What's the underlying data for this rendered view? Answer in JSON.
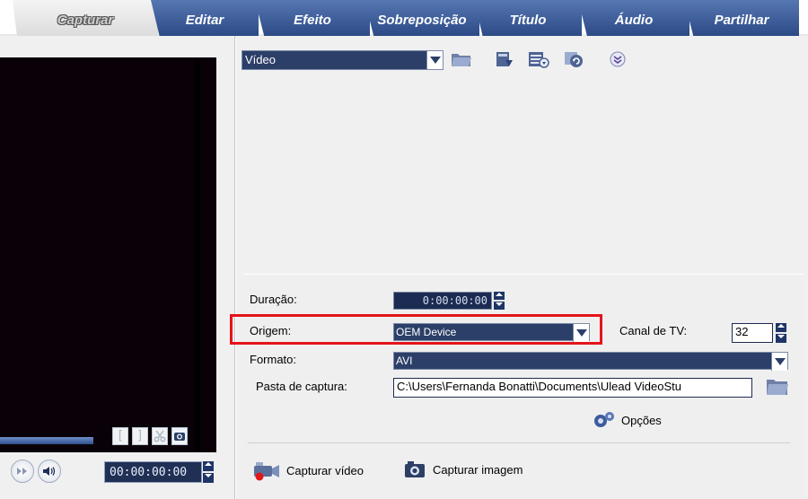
{
  "tabs": [
    {
      "label": "Capturar",
      "active": true
    },
    {
      "label": "Editar",
      "active": false
    },
    {
      "label": "Efeito",
      "active": false
    },
    {
      "label": "Sobreposição",
      "active": false
    },
    {
      "label": "Título",
      "active": false
    },
    {
      "label": "Áudio",
      "active": false
    },
    {
      "label": "Partilhar",
      "active": false
    }
  ],
  "preview": {
    "timecode": "00:00:00:00",
    "controls": [
      "mark-in",
      "mark-out",
      "cut",
      "snapshot",
      "fast-forward",
      "volume"
    ]
  },
  "library": {
    "category": "Vídeo",
    "icons": [
      "folder-icon",
      "import-icon",
      "options-icon",
      "sort-icon",
      "expand-icon"
    ]
  },
  "capture_options": {
    "duration_label": "Duração:",
    "duration_value": "0:00:00:00",
    "source_label": "Origem:",
    "source_value": "OEM Device",
    "tv_channel_label": "Canal de TV:",
    "tv_channel_value": "32",
    "format_label": "Formato:",
    "format_value": "AVI",
    "folder_label": "Pasta de captura:",
    "folder_value": "C:\\Users\\Fernanda Bonatti\\Documents\\Ulead VideoStu",
    "options_button": "Opções",
    "capture_video_button": "Capturar vídeo",
    "capture_image_button": "Capturar imagem"
  },
  "colors": {
    "highlight": "#e5141a",
    "tab_blue": "#2c4a86",
    "field_dark": "#2c3f68"
  }
}
